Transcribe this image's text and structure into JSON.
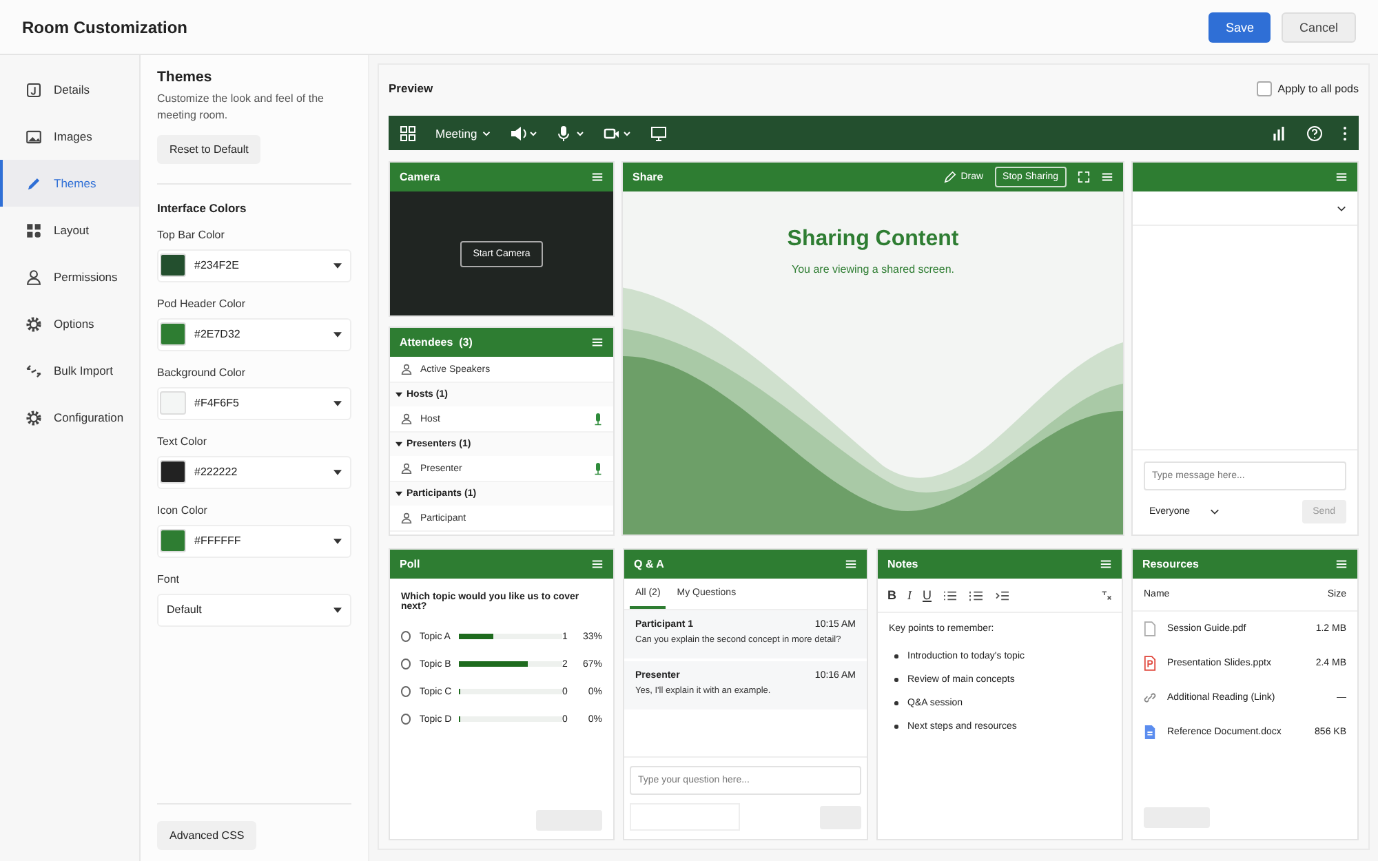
{
  "header": {
    "title": "Room Customization",
    "save": "Save",
    "cancel": "Cancel"
  },
  "nav": [
    {
      "label": "Details",
      "selected": false
    },
    {
      "label": "Images",
      "selected": false
    },
    {
      "label": "Themes",
      "selected": true
    },
    {
      "label": "Layout",
      "selected": false
    },
    {
      "label": "Permissions",
      "selected": false
    },
    {
      "label": "Options",
      "selected": false
    },
    {
      "label": "Bulk Import",
      "selected": false
    },
    {
      "label": "Configuration",
      "selected": false
    }
  ],
  "themes": {
    "title": "Themes",
    "description": "Customize the look and feel of the meeting room.",
    "reset": "Reset to Default",
    "section": "Interface Colors",
    "colors": [
      {
        "label": "Top Bar Color",
        "value": "#234F2E",
        "color": "#234f2e"
      },
      {
        "label": "Pod Header Color",
        "value": "#2E7D32",
        "color": "#2e7d32"
      },
      {
        "label": "Background Color",
        "value": "#F4F6F5",
        "color": "#f4f6f5"
      },
      {
        "label": "Text Color",
        "value": "#222222",
        "color": "#222222"
      },
      {
        "label": "Icon Color",
        "value": "#FFFFFF",
        "color": "#2e7d32"
      }
    ],
    "font_label": "Font",
    "font_value": "Default",
    "advanced": "Advanced CSS"
  },
  "preview": {
    "title": "Preview",
    "apply_all": {
      "label": "Apply to all pods",
      "checked": false
    },
    "topbar": {
      "menu": "Meeting"
    },
    "camera": {
      "title": "Camera",
      "button": "Start Camera"
    },
    "attendees": {
      "title": "Attendees",
      "count": "(3)",
      "active": "Active Speakers",
      "groups": [
        {
          "label": "Hosts (1)",
          "expanded": true,
          "children": [
            {
              "name": "Host",
              "mic": true
            }
          ]
        },
        {
          "label": "Presenters (1)",
          "expanded": true,
          "children": [
            {
              "name": "Presenter",
              "mic": true
            }
          ]
        },
        {
          "label": "Participants (1)",
          "expanded": true,
          "children": [
            {
              "name": "Participant",
              "mic": false
            }
          ]
        }
      ]
    },
    "share": {
      "title": "Share",
      "draw": "Draw",
      "stop": "Stop Sharing",
      "heading": "Sharing Content",
      "subtitle": "You are viewing a shared screen."
    },
    "chat": {
      "placeholder": "Type message here...",
      "audience": "Everyone",
      "send": "Send"
    },
    "poll": {
      "title": "Poll",
      "question": "Which topic would you like us to cover next?",
      "options": [
        {
          "label": "Topic A",
          "count": "1",
          "percent": "33%",
          "level": 0.33,
          "selected": false
        },
        {
          "label": "Topic B",
          "count": "2",
          "percent": "67%",
          "level": 0.67,
          "selected": false
        },
        {
          "label": "Topic C",
          "count": "0",
          "percent": "0%",
          "level": 0,
          "selected": false
        },
        {
          "label": "Topic D",
          "count": "0",
          "percent": "0%",
          "level": 0,
          "selected": false
        }
      ]
    },
    "qa": {
      "title": "Q & A",
      "tabs": [
        {
          "label": "All (2)",
          "selected": true
        },
        {
          "label": "My Questions",
          "selected": false
        }
      ],
      "messages": [
        {
          "author": "Participant 1",
          "time": "10:15 AM",
          "text": "Can you explain the second concept in more detail?"
        },
        {
          "author": "Presenter",
          "time": "10:16 AM",
          "text": "Yes, I'll explain it with an example."
        }
      ],
      "placeholder": "Type your question here..."
    },
    "notes": {
      "title": "Notes",
      "toolbar": [
        "B",
        "I",
        "U"
      ],
      "heading": "Key points to remember:",
      "bullets": [
        "Introduction to today's topic",
        "Review of main concepts",
        "Q&A session",
        "Next steps and resources"
      ]
    },
    "resources": {
      "title": "Resources",
      "columns": [
        "Name",
        "Size"
      ],
      "files": [
        {
          "kind": "file",
          "name": "Session Guide.pdf",
          "size": "1.2 MB"
        },
        {
          "kind": "slides",
          "name": "Presentation Slides.pptx",
          "size": "2.4 MB"
        },
        {
          "kind": "link",
          "name": "Additional Reading (Link)",
          "size": "—"
        },
        {
          "kind": "document",
          "name": "Reference Document.docx",
          "size": "856 KB"
        }
      ]
    }
  }
}
